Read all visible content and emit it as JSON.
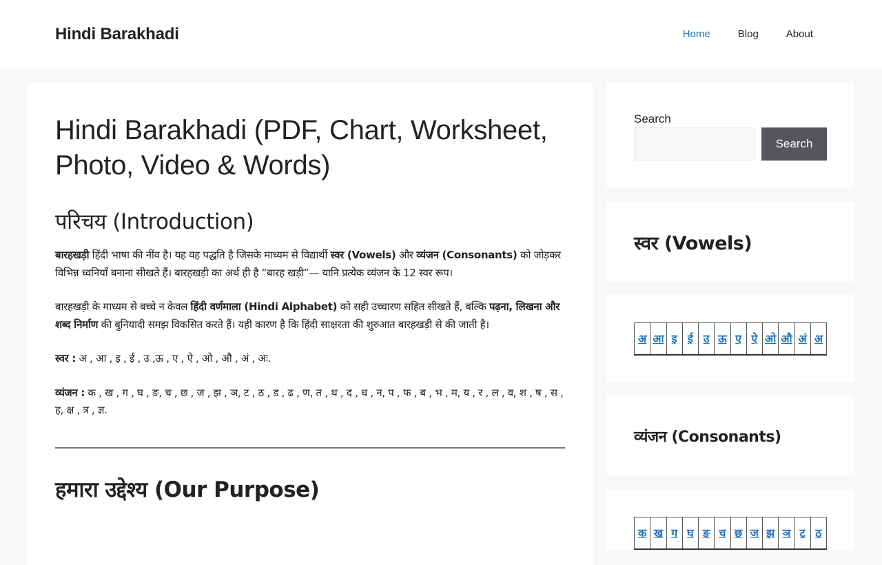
{
  "header": {
    "site_title": "Hindi Barakhadi",
    "nav": [
      {
        "label": "Home",
        "active": true
      },
      {
        "label": "Blog",
        "active": false
      },
      {
        "label": "About",
        "active": false
      }
    ]
  },
  "article": {
    "title": "Hindi Barakhadi (PDF, Chart, Worksheet, Photo, Video & Words)",
    "intro_heading": "परिचय (Introduction)",
    "p1": {
      "b1": "बारहखड़ी",
      "t1": " हिंदी भाषा की नींव है। यह वह पद्धति है जिसके माध्यम से विद्यार्थी ",
      "b2": "स्वर (Vowels)",
      "t2": " और ",
      "b3": "व्यंजन (Consonants)",
      "t3": " को जोड़कर विभिन्न ध्वनियाँ बनाना सीखते हैं। बारहखड़ी का अर्थ ही है “बारह खड़ी”— यानि प्रत्येक व्यंजन के 12 स्वर रूप।"
    },
    "p2": {
      "t1": "बारहखड़ी के माध्यम से बच्चे न केवल ",
      "b1": "हिंदी वर्णमाला (Hindi Alphabet)",
      "t2": " को सही उच्चारण सहित सीखते हैं, बल्कि ",
      "b2": "पढ़ना, लिखना और शब्द निर्माण",
      "t3": " की बुनियादी समझ विकसित करते हैं। यही कारण है कि हिंदी साक्षरता की शुरुआत बारहखड़ी से की जाती है।"
    },
    "p3": {
      "label": "स्वर :",
      "text": " अ , आ , इ , ई , उ ,ऊ , ए , ऐ , ओ , औ , अं , अः."
    },
    "p4": {
      "label": "व्यंजन :",
      "text": " क , ख , ग , घ , ङ, च , छ , ज , झ , ञ, ट , ठ , ड , ढ , ण, त , थ , द , ध , न, प , फ , ब , भ , म, य , र , ल , व, श , ष , स , ह, क्ष , त्र , ज्ञ."
    },
    "purpose_heading": "हमारा उद्देश्य (Our Purpose)"
  },
  "sidebar": {
    "search_label": "Search",
    "search_placeholder": "",
    "search_button": "Search",
    "vowels_heading": "स्वर (Vowels)",
    "vowels": [
      "अ",
      "आ",
      "इ",
      "ई",
      "उ",
      "ऊ",
      "ए",
      "ऐ",
      "ओ",
      "औ",
      "अं",
      "अ"
    ],
    "consonants_heading": "व्यंजन (Consonants)",
    "consonants": [
      "क",
      "ख",
      "ग",
      "घ",
      "ङ",
      "च",
      "छ",
      "ज",
      "झ",
      "ञ",
      "ट",
      "ठ"
    ]
  },
  "colors": {
    "link": "#1e73be",
    "page_bg": "#f7f8f9",
    "button_bg": "#55555e"
  }
}
